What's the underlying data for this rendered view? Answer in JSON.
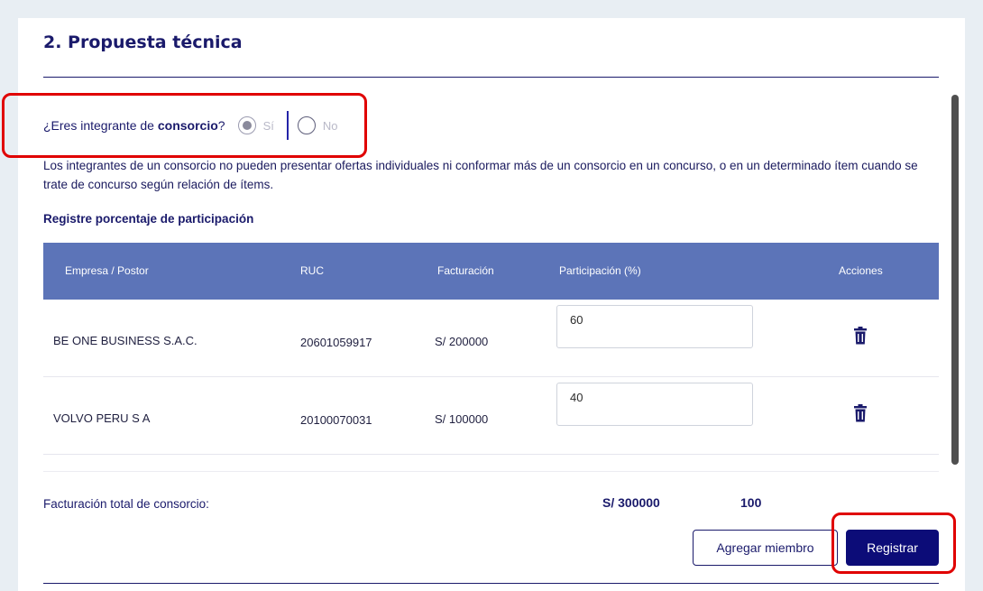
{
  "section": {
    "title": "2. Propuesta técnica"
  },
  "consorcio_question": {
    "prefix": "¿Eres integrante de ",
    "bold": "consorcio",
    "suffix": "?",
    "option_yes": "Sí",
    "option_no": "No",
    "selected": "Sí"
  },
  "note": "Los integrantes de un consorcio no pueden presentar ofertas individuales ni conformar más de un consorcio en un concurso, o en un determinado ítem cuando se trate de concurso según relación de ítems.",
  "participation_title": "Registre porcentaje de participación",
  "table": {
    "headers": {
      "empresa": "Empresa / Postor",
      "ruc": "RUC",
      "facturacion": "Facturación",
      "participacion": "Participación (%)",
      "acciones": "Acciones"
    },
    "rows": [
      {
        "empresa": "BE ONE BUSINESS S.A.C.",
        "ruc": "20601059917",
        "facturacion": "S/ 200000",
        "participacion": "60"
      },
      {
        "empresa": "VOLVO PERU S A",
        "ruc": "20100070031",
        "facturacion": "S/ 100000",
        "participacion": "40"
      }
    ]
  },
  "totals": {
    "label": "Facturación total de consorcio:",
    "facturacion": "S/ 300000",
    "participacion": "100"
  },
  "buttons": {
    "add_member": "Agregar miembro",
    "register": "Registrar"
  },
  "colors": {
    "table_header": "#5c74b8",
    "primary": "#0c0c78",
    "highlight": "#e00000"
  }
}
